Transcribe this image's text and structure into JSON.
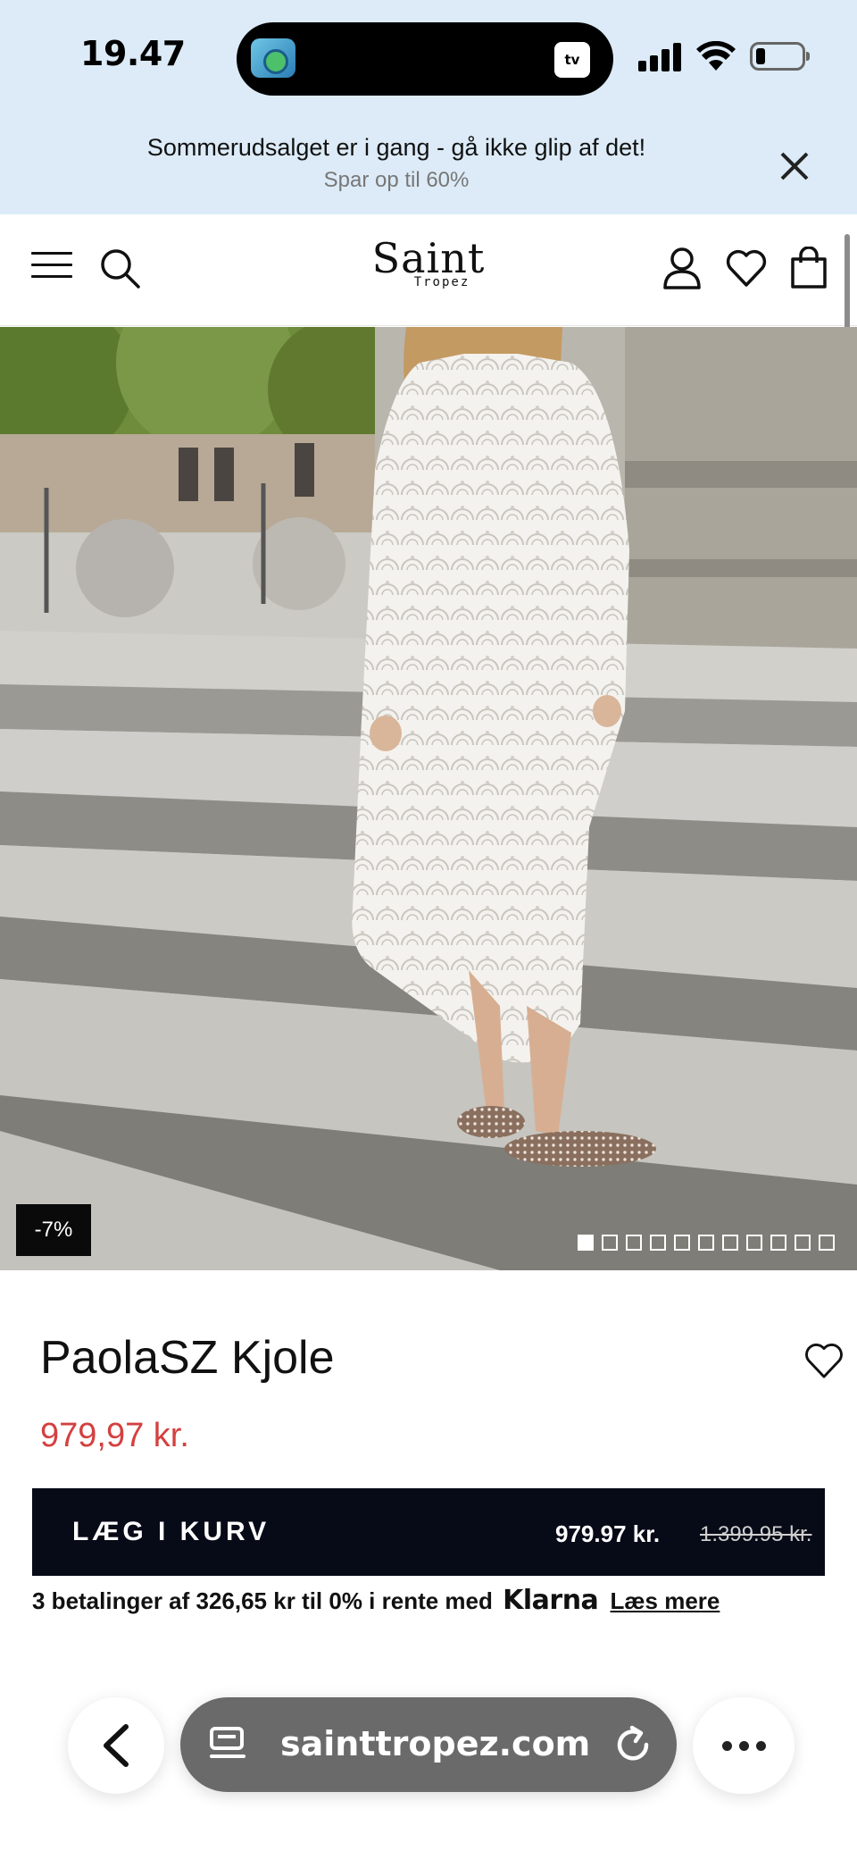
{
  "status_bar": {
    "time": "19.47",
    "tv_label": "tv",
    "icons": [
      "app-icon",
      "appletv-icon",
      "signal-icon",
      "wifi-icon",
      "battery-icon"
    ]
  },
  "promo": {
    "text": "Sommerudsalget er i gang - gå ikke glip af det!",
    "subtext": "Spar op til 60%"
  },
  "header": {
    "logo_main": "Saint",
    "logo_sub": "Tropez",
    "icons": [
      "menu-icon",
      "search-icon",
      "user-icon",
      "heart-icon",
      "bag-icon"
    ]
  },
  "gallery": {
    "badge": "-7%",
    "image_count": 11,
    "active_index": 0
  },
  "product": {
    "name": "PaolaSZ Kjole",
    "price": "979,97 kr."
  },
  "cart_button": {
    "label": "LÆG I KURV",
    "price": "979.97 kr.",
    "old_price": "1.399.95 kr."
  },
  "klarna": {
    "text": "3 betalinger af 326,65 kr til 0% i rente med",
    "brand": "Klarna",
    "link": "Læs mere"
  },
  "browser": {
    "url": "sainttropez.com"
  },
  "colors": {
    "promo_bg": "#dcebf7",
    "price_red": "#d44040",
    "cart_bg": "#070a17"
  }
}
